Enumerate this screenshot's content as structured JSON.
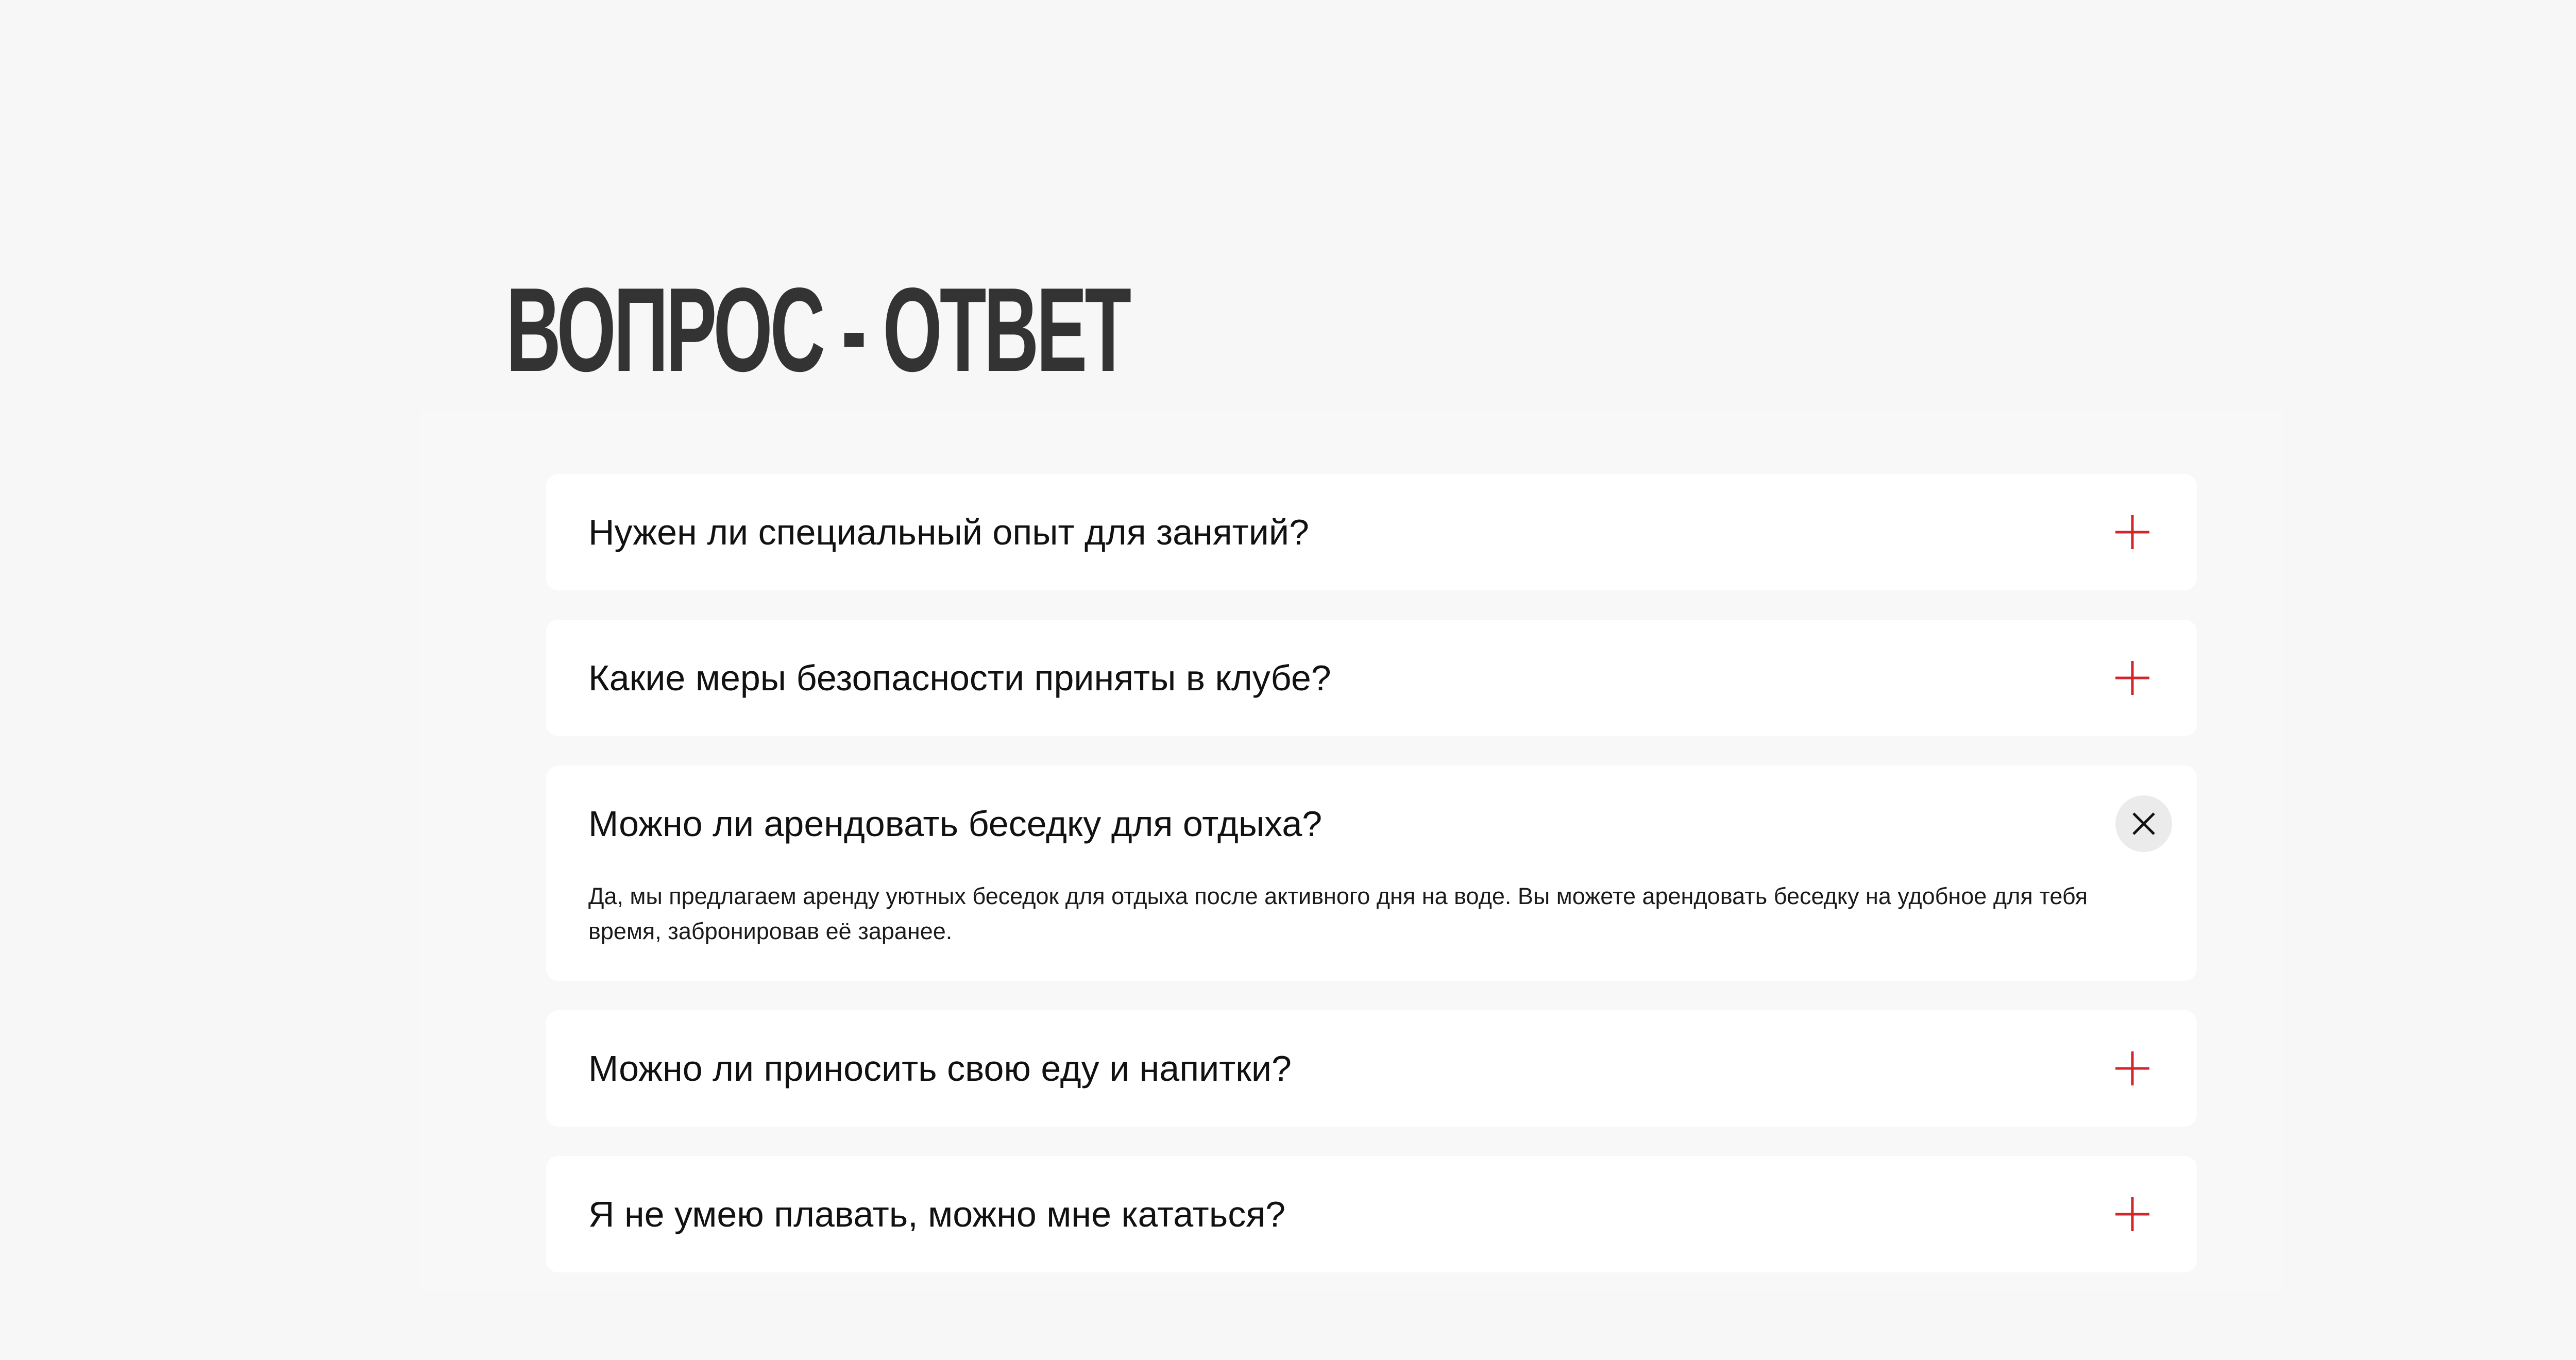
{
  "faq": {
    "title": "ВОПРОС - ОТВЕТ",
    "items": [
      {
        "question": "Нужен ли специальный опыт для занятий?",
        "state": "collapsed",
        "icon": "plus-icon"
      },
      {
        "question": "Какие меры безопасности приняты в клубе?",
        "state": "collapsed",
        "icon": "plus-icon"
      },
      {
        "question": "Можно ли арендовать беседку для отдыха?",
        "state": "expanded",
        "icon": "close-icon",
        "answer": "Да, мы предлагаем аренду уютных беседок для отдыха после активного дня на воде. Вы можете арендовать беседку на удобное для тебя время, забронировав её заранее."
      },
      {
        "question": "Можно ли приносить свою еду и напитки?",
        "state": "collapsed",
        "icon": "plus-icon"
      },
      {
        "question": "Я не умею плавать, можно мне кататься?",
        "state": "collapsed",
        "icon": "plus-icon"
      }
    ]
  },
  "colors": {
    "accent": "#d6242b",
    "background": "#f7f7f7",
    "card": "#ffffff",
    "title": "#333333"
  }
}
